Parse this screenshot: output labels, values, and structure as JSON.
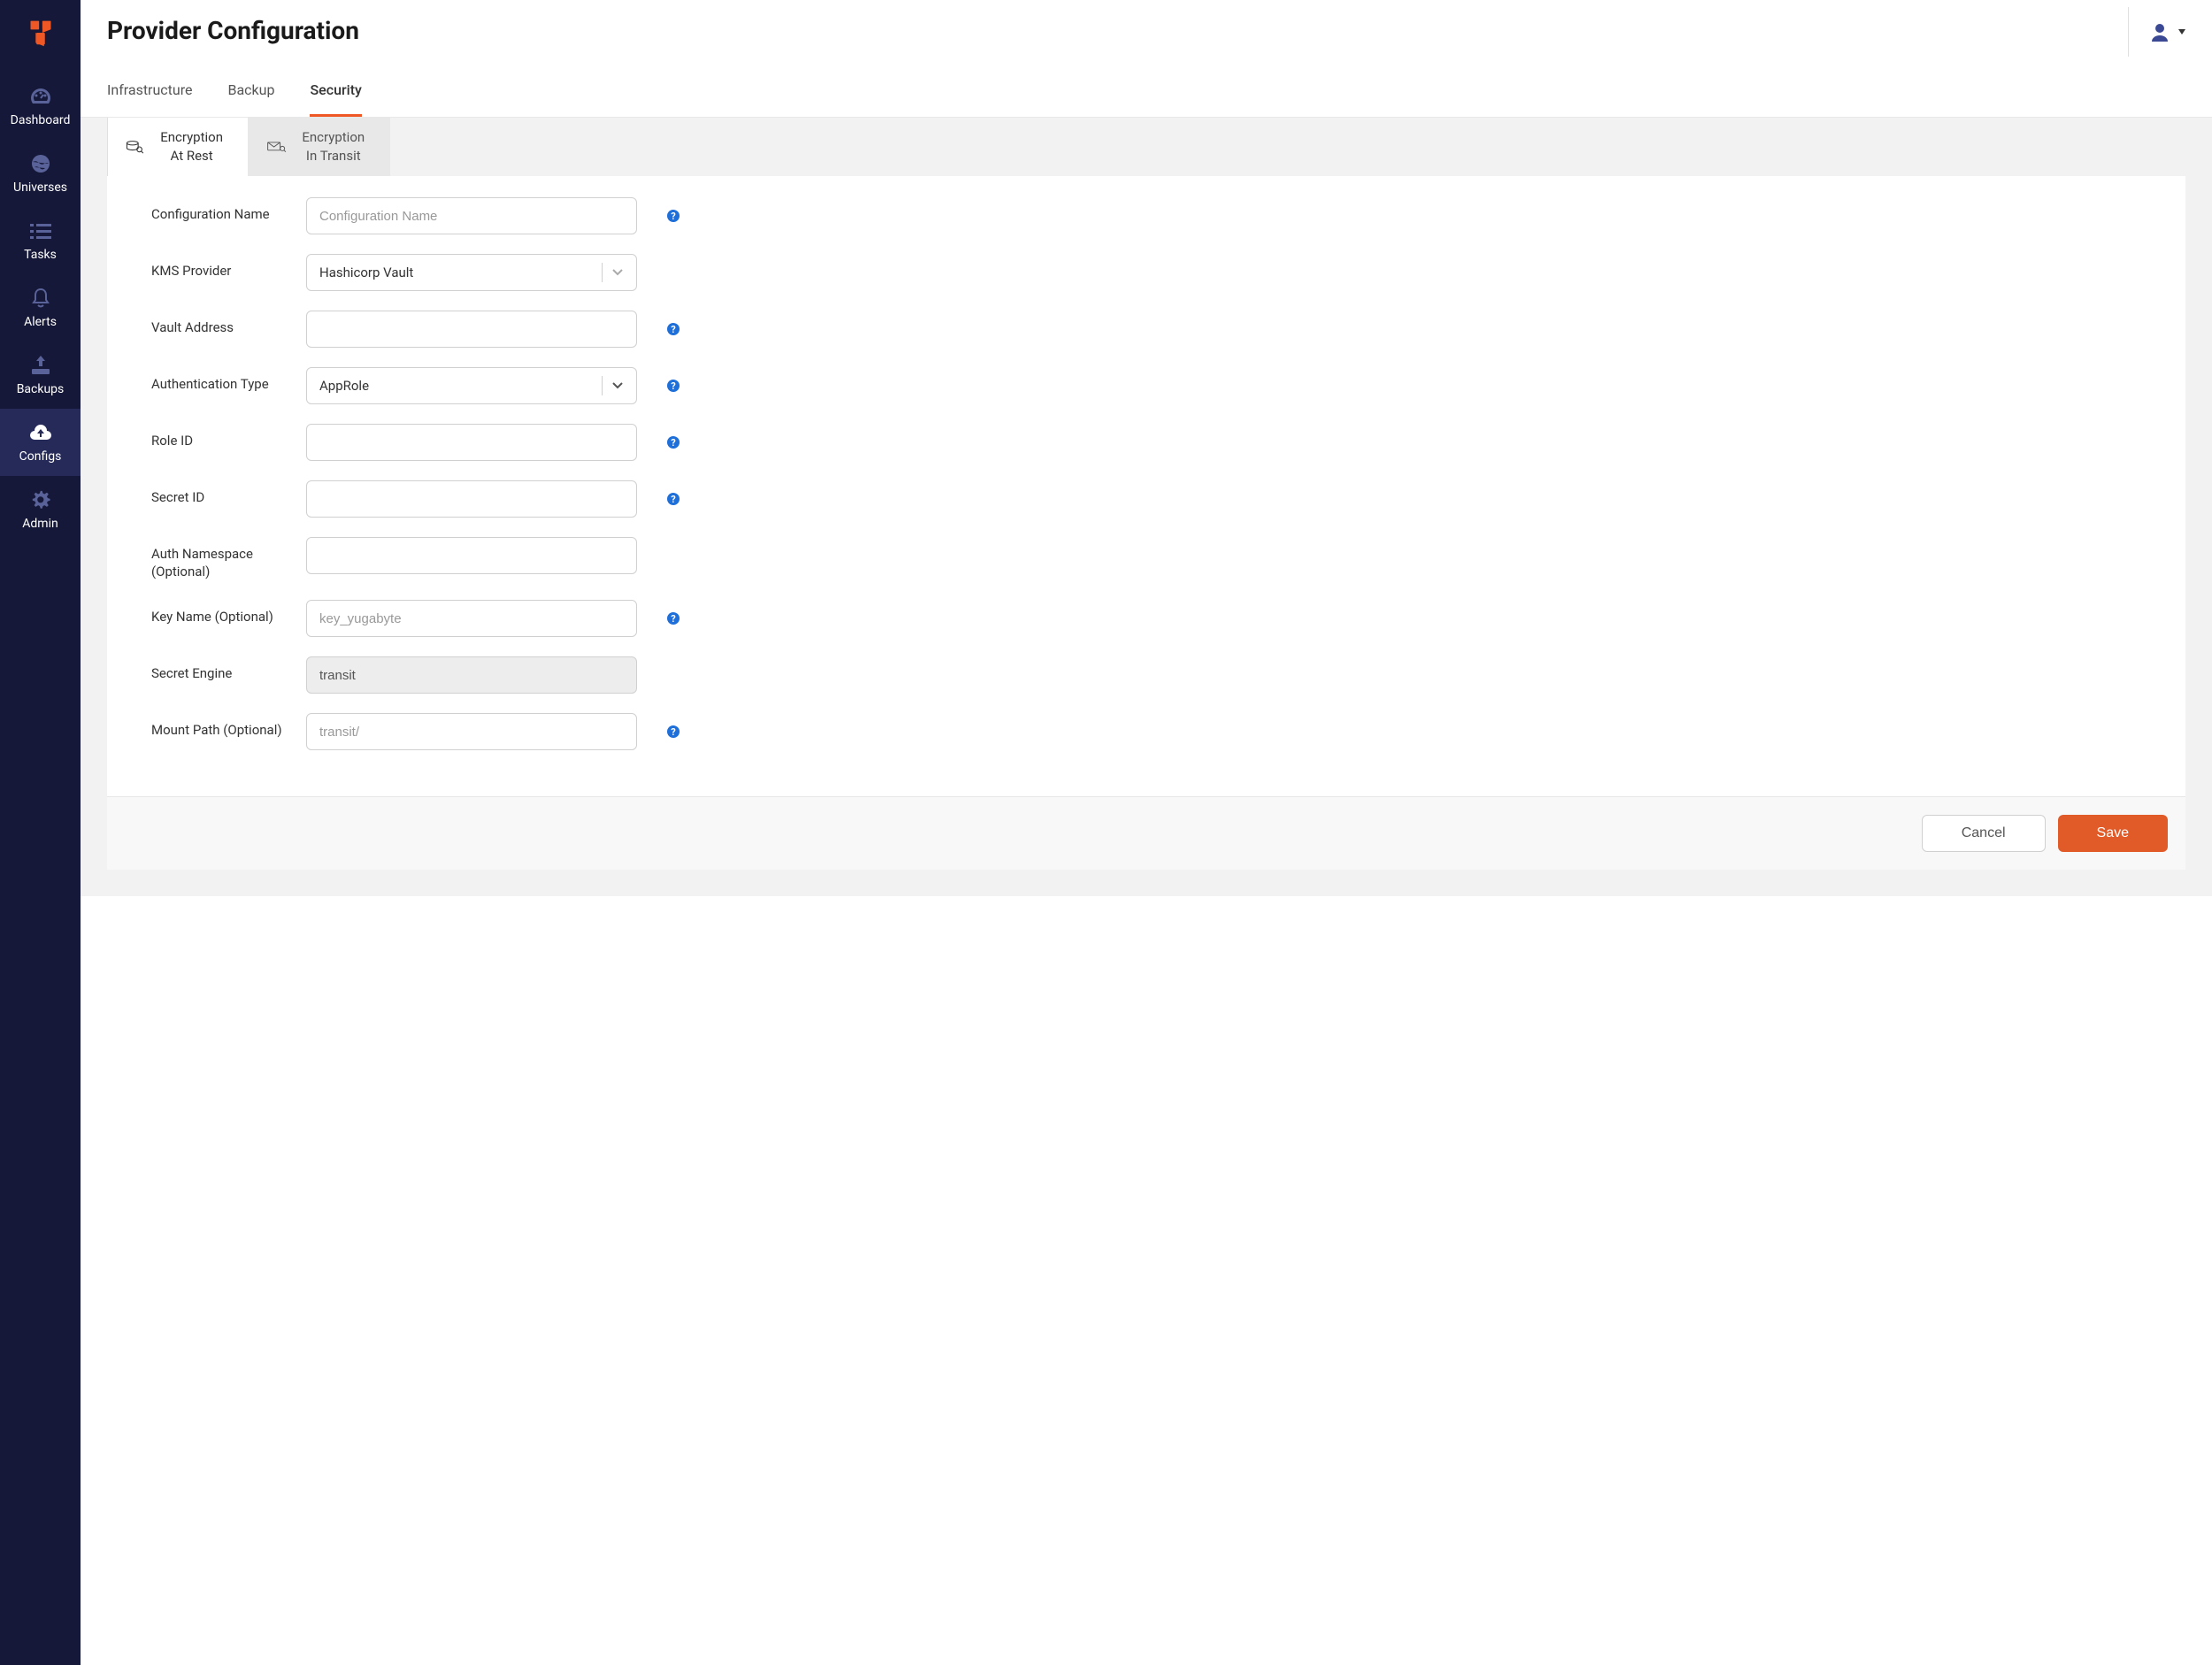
{
  "page_title": "Provider Configuration",
  "sidebar": {
    "items": [
      {
        "label": "Dashboard"
      },
      {
        "label": "Universes"
      },
      {
        "label": "Tasks"
      },
      {
        "label": "Alerts"
      },
      {
        "label": "Backups"
      },
      {
        "label": "Configs"
      },
      {
        "label": "Admin"
      }
    ]
  },
  "tabs": [
    {
      "label": "Infrastructure"
    },
    {
      "label": "Backup"
    },
    {
      "label": "Security"
    }
  ],
  "subtabs": [
    {
      "label": "Encryption At Rest"
    },
    {
      "label": "Encryption In Transit"
    }
  ],
  "form": {
    "config_name": {
      "label": "Configuration Name",
      "placeholder": "Configuration Name",
      "value": ""
    },
    "kms_provider": {
      "label": "KMS Provider",
      "value": "Hashicorp Vault"
    },
    "vault_address": {
      "label": "Vault Address",
      "value": ""
    },
    "auth_type": {
      "label": "Authentication Type",
      "value": "AppRole"
    },
    "role_id": {
      "label": "Role ID",
      "value": ""
    },
    "secret_id": {
      "label": "Secret ID",
      "value": ""
    },
    "auth_namespace": {
      "label": "Auth Namespace (Optional)",
      "value": ""
    },
    "key_name": {
      "label": "Key Name (Optional)",
      "placeholder": "key_yugabyte",
      "value": ""
    },
    "secret_engine": {
      "label": "Secret Engine",
      "value": "transit"
    },
    "mount_path": {
      "label": "Mount Path (Optional)",
      "placeholder": "transit/",
      "value": ""
    }
  },
  "buttons": {
    "cancel": "Cancel",
    "save": "Save"
  }
}
